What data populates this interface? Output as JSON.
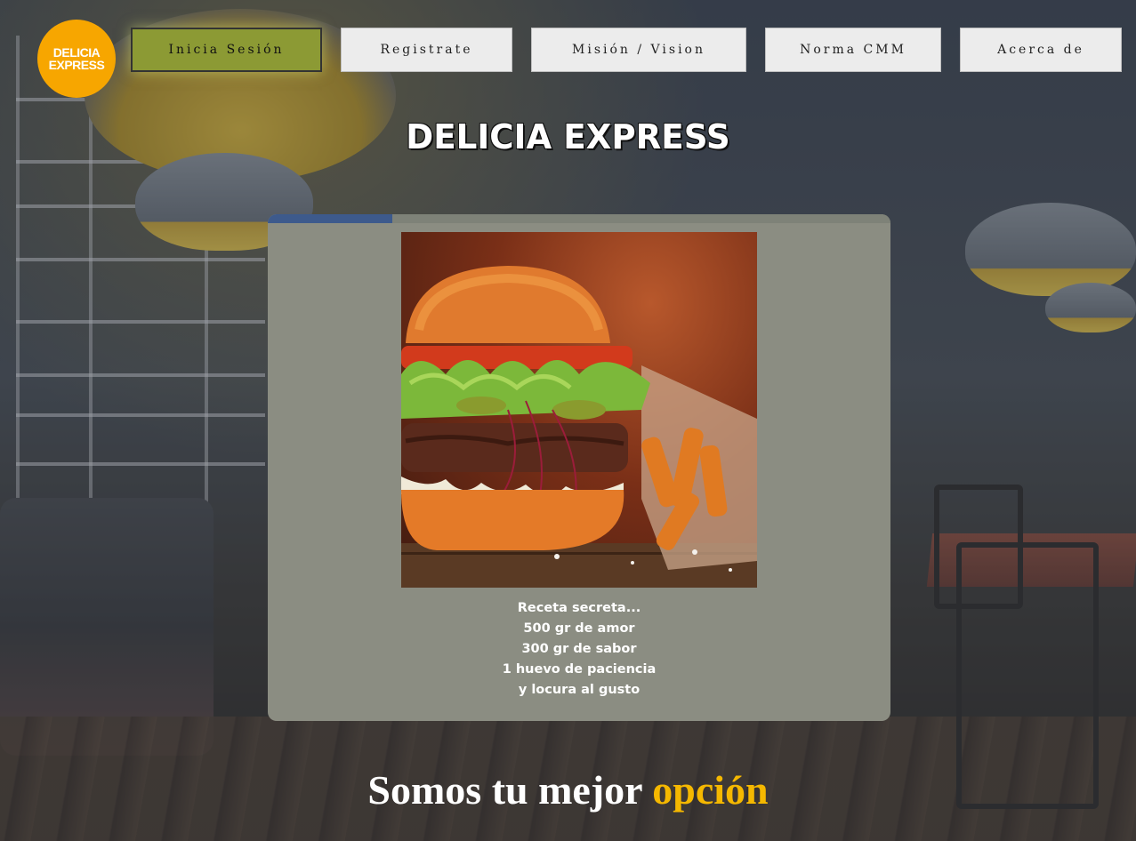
{
  "logo": {
    "line1": "DELICIA",
    "line2": "EXPRESS",
    "color": "#f7a600"
  },
  "nav": {
    "items": [
      {
        "label": "Inicia Sesión",
        "active": true
      },
      {
        "label": "Registrate",
        "active": false
      },
      {
        "label": "Misión / Vision",
        "active": false
      },
      {
        "label": "Norma CMM",
        "active": false
      },
      {
        "label": "Acerca de",
        "active": false
      }
    ],
    "active_color": "#8c9a34"
  },
  "site_title": "Delicia Express",
  "card": {
    "progress": 0.2,
    "image": "burger-photo",
    "recipe_lines": [
      "Receta secreta...",
      "500 gr de amor",
      "300 gr de sabor",
      "1 huevo de paciencia",
      "y locura al gusto"
    ],
    "background_color": "#8b8d82"
  },
  "tagline": {
    "main": "Somos tu mejor ",
    "accent": "opción",
    "accent_color": "#f5b800"
  }
}
